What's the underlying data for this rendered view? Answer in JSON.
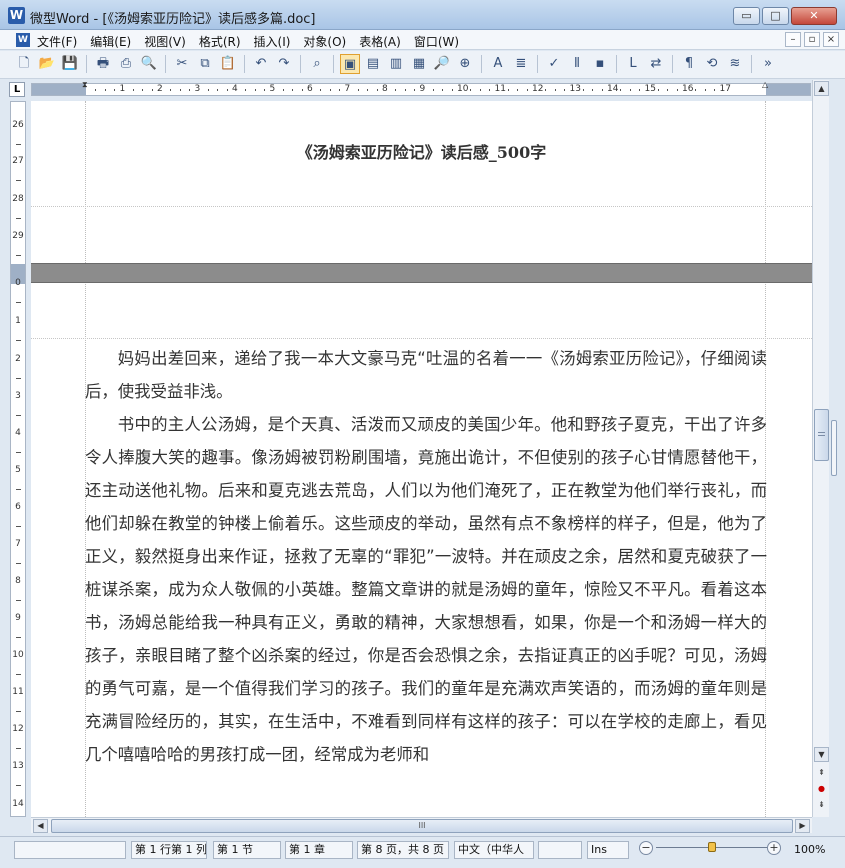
{
  "window": {
    "app_icon": "W",
    "title": "微型Word - [《汤姆索亚历险记》读后感多篇.doc]",
    "minimize": "▭",
    "maximize": "□",
    "close": "✕"
  },
  "menu": {
    "items": [
      "文件(F)",
      "编辑(E)",
      "视图(V)",
      "格式(R)",
      "插入(I)",
      "对象(O)",
      "表格(A)",
      "窗口(W)"
    ],
    "mdi_minimize": "–",
    "mdi_restore": "▫",
    "mdi_close": "×"
  },
  "toolbar": {
    "icons": [
      "new-icon",
      "open-icon",
      "save-icon",
      "print-icon",
      "pdf-icon",
      "print-preview-icon",
      "cut-icon",
      "copy-icon",
      "paste-icon",
      "undo-icon",
      "redo-icon",
      "find-icon",
      "view-page-icon",
      "view-web-icon",
      "view-outline-icon",
      "view-draft-icon",
      "zoom-icon",
      "zoom-page-icon",
      "font-color-icon",
      "word-count-icon",
      "spell-check-icon",
      "columns-icon",
      "shadow-icon",
      "border-icon",
      "replace-icon",
      "paragraph-mark-icon",
      "format-painter-icon",
      "clear-format-icon",
      "more-icon"
    ],
    "glyphs": [
      "🗋",
      "📂",
      "💾",
      "🖶",
      "⎙",
      "🔍",
      "✂",
      "⧉",
      "📋",
      "↶",
      "↷",
      "⌕",
      "▣",
      "▤",
      "▥",
      "▦",
      "🔎",
      "⊕",
      "A",
      "≣",
      "✓",
      "⫴",
      "▪",
      "L",
      "⇄",
      "¶",
      "⟲",
      "≋",
      "»"
    ],
    "more": "»"
  },
  "ruler": {
    "corner": "L",
    "h_numbers": [
      "1",
      "2",
      "3",
      "4",
      "5",
      "6",
      "7",
      "8",
      "9",
      "10",
      "11",
      "12",
      "13",
      "14",
      "15",
      "16",
      "17"
    ],
    "v_numbers": [
      "26",
      "27",
      "28",
      "29",
      "0",
      "1",
      "2",
      "3",
      "4",
      "5",
      "6",
      "7",
      "8",
      "9",
      "10",
      "11",
      "12",
      "13",
      "14"
    ]
  },
  "document": {
    "title": "《汤姆索亚历险记》读后感_500字",
    "paragraphs": [
      "妈妈出差回来，递给了我一本大文豪马克“吐温的名着一一《汤姆索亚历险记》，仔细阅读后，使我受益非浅。",
      "书中的主人公汤姆，是个天真、活泼而又顽皮的美国少年。他和野孩子夏克，干出了许多令人捧腹大笑的趣事。像汤姆被罚粉刷围墙，竟施出诡计，不但使别的孩子心甘情愿替他干，还主动送他礼物。后来和夏克逃去荒岛，人们以为他们淹死了，正在教堂为他们举行丧礼，而他们却躲在教堂的钟楼上偷着乐。这些顽皮的举动，虽然有点不象榜样的样子，但是，他为了正义，毅然挺身出来作证，拯救了无辜的“罪犯”一波特。并在顽皮之余，居然和夏克破获了一桩谋杀案，成为众人敬佩的小英雄。整篇文章讲的就是汤姆的童年，惊险又不平凡。看着这本书，汤姆总能给我一种具有正义，勇敢的精神，大家想想看，如果，你是一个和汤姆一样大的孩子，亲眼目睹了整个凶杀案的经过，你是否会恐惧之余，去指证真正的凶手呢？可见，汤姆的勇气可嘉，是一个值得我们学习的孩子。我们的童年是充满欢声笑语的，而汤姆的童年则是充满冒险经历的，其实，在生活中，不难看到同样有这样的孩子：可以在学校的走廊上，看见几个嘻嘻哈哈的男孩打成一团，经常成为老师和"
    ]
  },
  "scrollbar": {
    "up": "▲",
    "down": "▼",
    "prev_page": "⇞",
    "select_browse": "●",
    "next_page": "⇟",
    "left": "◀",
    "right": "▶",
    "thumb_grip": "III"
  },
  "status": {
    "line_col": "第 1 行第 1 列",
    "section": "第 1 节",
    "chapter": "第 1 章",
    "page": "第 8 页，共 8 页",
    "language": "中文（中华人",
    "ins": "Ins",
    "zoom": "100%",
    "zoom_minus": "−",
    "zoom_plus": "+",
    "zoom_level": 0.5
  }
}
